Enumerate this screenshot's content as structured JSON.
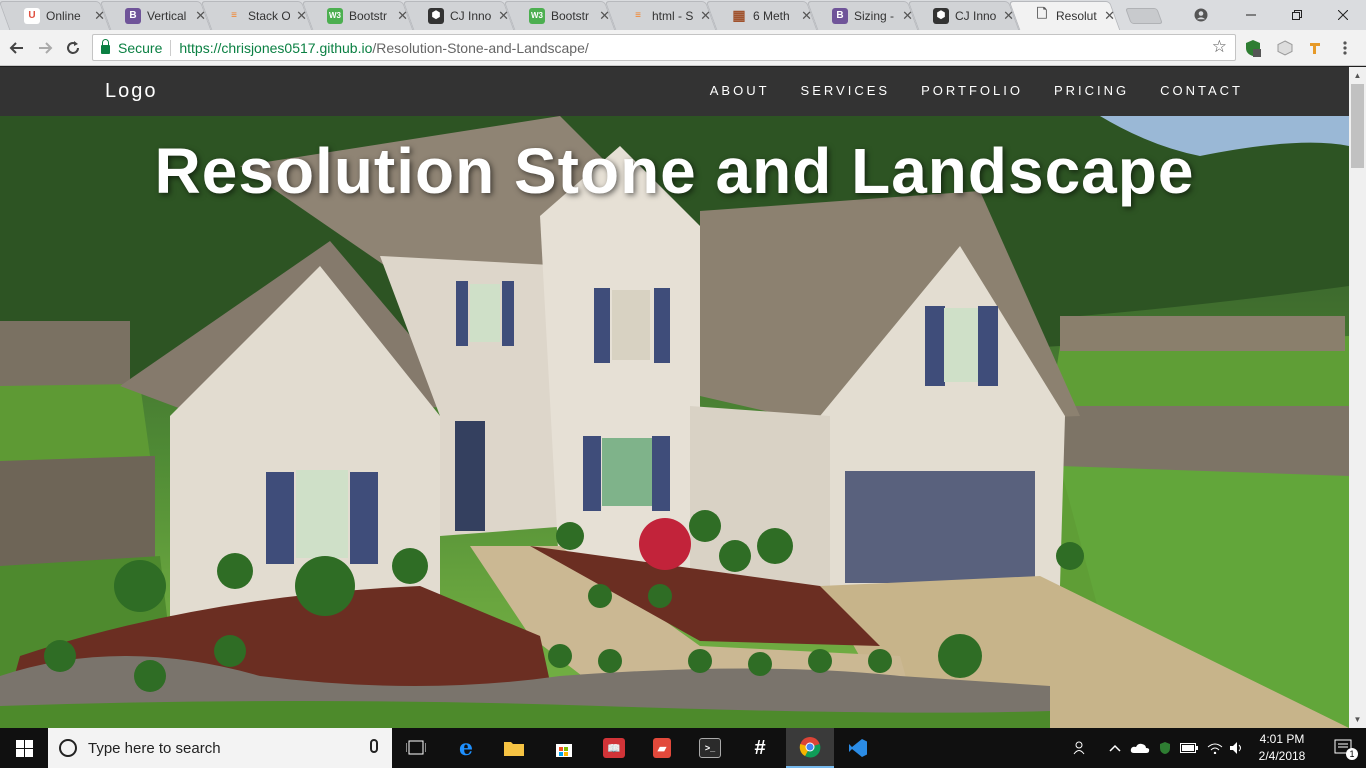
{
  "browser": {
    "tabs": [
      {
        "title": "Online",
        "favicon": "U",
        "favicon_color": "#e04f3f"
      },
      {
        "title": "Vertical",
        "favicon": "B",
        "favicon_color": "#6f5499"
      },
      {
        "title": "Stack O",
        "favicon": "≡",
        "favicon_color": "#f48024"
      },
      {
        "title": "Bootstr",
        "favicon": "W3",
        "favicon_color": "#4caf50"
      },
      {
        "title": "CJ Inno",
        "favicon": "⬢",
        "favicon_color": "#333333"
      },
      {
        "title": "Bootstr",
        "favicon": "W3",
        "favicon_color": "#4caf50"
      },
      {
        "title": "html - S",
        "favicon": "≡",
        "favicon_color": "#f48024"
      },
      {
        "title": "6 Meth",
        "favicon": "▦",
        "favicon_color": "#a0522d"
      },
      {
        "title": "Sizing -",
        "favicon": "B",
        "favicon_color": "#6f5499"
      },
      {
        "title": "CJ Inno",
        "favicon": "⬢",
        "favicon_color": "#333333"
      },
      {
        "title": "Resolut",
        "favicon": "🗋",
        "favicon_color": "#f2f2f2"
      }
    ],
    "close_glyph": "✕",
    "secure_label": "Secure",
    "url_host": "https://chrisjones0517.github.io",
    "url_path": "/Resolution-Stone-and-Landscape/"
  },
  "site": {
    "logo": "Logo",
    "nav": [
      "ABOUT",
      "SERVICES",
      "PORTFOLIO",
      "PRICING",
      "CONTACT"
    ],
    "hero_title": "Resolution Stone and Landscape"
  },
  "taskbar": {
    "search_placeholder": "Type here to search",
    "time": "4:01 PM",
    "date": "2/4/2018",
    "notification_count": "1"
  }
}
